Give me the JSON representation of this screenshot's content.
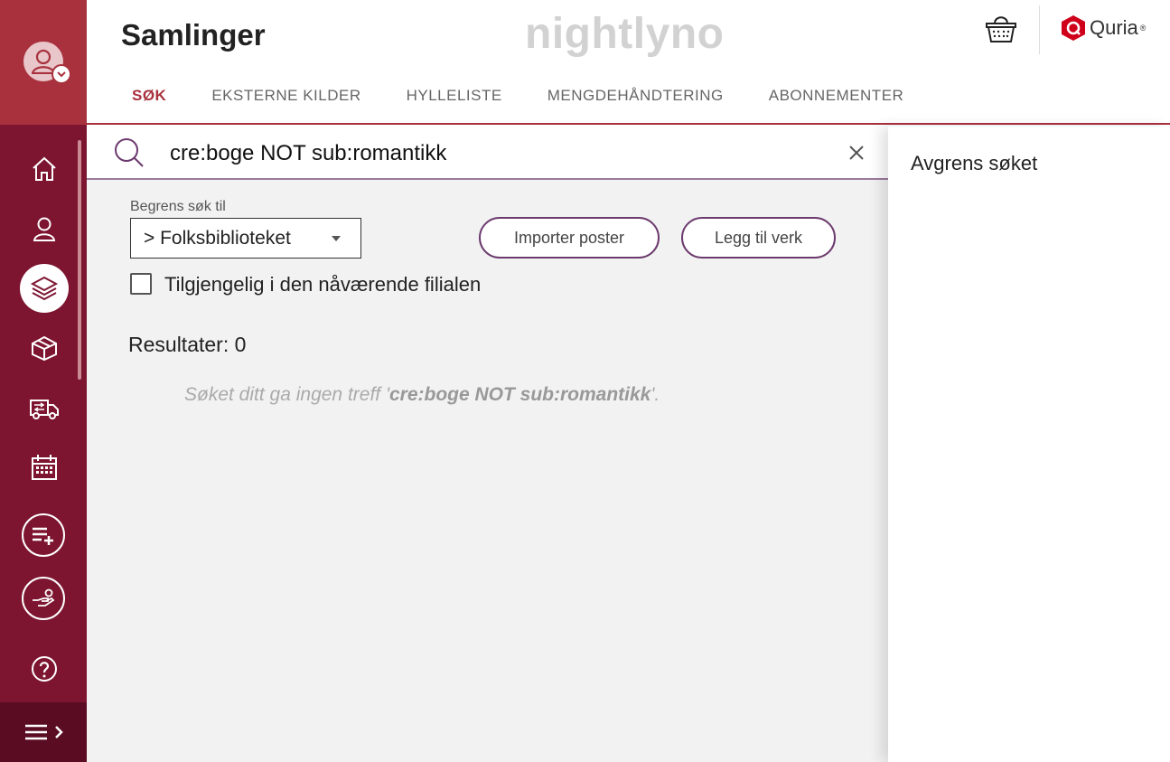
{
  "app": {
    "title": "Samlinger",
    "environment": "nightlyno",
    "brand": "Quria",
    "brand_mark": "®"
  },
  "header": {
    "tabs": [
      {
        "label": "SØK",
        "active": true
      },
      {
        "label": "EKSTERNE KILDER",
        "active": false
      },
      {
        "label": "HYLLELISTE",
        "active": false
      },
      {
        "label": "MENGDEHÅNDTERING",
        "active": false
      },
      {
        "label": "ABONNEMENTER",
        "active": false
      }
    ]
  },
  "sidebar": {
    "items": [
      {
        "icon": "home-icon"
      },
      {
        "icon": "user-icon"
      },
      {
        "icon": "layers-icon",
        "active": true
      },
      {
        "icon": "box-icon"
      },
      {
        "icon": "truck-icon"
      },
      {
        "icon": "calendar-icon"
      },
      {
        "icon": "add-list-icon"
      },
      {
        "icon": "hand-icon"
      },
      {
        "icon": "help-icon"
      }
    ]
  },
  "search": {
    "query": "cre:boge NOT sub:romantikk"
  },
  "filters": {
    "limit_label": "Begrens søk til",
    "limit_value": "> Folksbiblioteket",
    "available_label": "Tilgjengelig i den nåværende filialen",
    "available_checked": false
  },
  "actions": {
    "import_label": "Importer poster",
    "add_work_label": "Legg til verk"
  },
  "results": {
    "count_text": "Resultater: 0",
    "no_hits_prefix": "Søket ditt ga ingen treff '",
    "no_hits_query": "cre:boge NOT sub:romantikk",
    "no_hits_suffix": "'."
  },
  "refine": {
    "title": "Avgrens søket"
  },
  "colors": {
    "brand": "#a8313d",
    "sidebar": "#7d1530",
    "accent": "#6c3a6e"
  }
}
